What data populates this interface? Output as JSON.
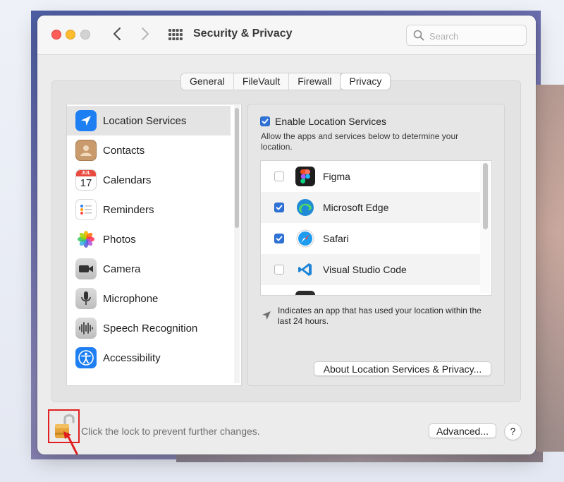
{
  "window": {
    "title": "Security & Privacy",
    "search_placeholder": "Search"
  },
  "tabs": [
    {
      "label": "General"
    },
    {
      "label": "FileVault"
    },
    {
      "label": "Firewall"
    },
    {
      "label": "Privacy",
      "active": true
    }
  ],
  "sidebar": {
    "items": [
      {
        "label": "Location Services",
        "icon": "location-arrow-icon",
        "selected": true
      },
      {
        "label": "Contacts",
        "icon": "contacts-icon"
      },
      {
        "label": "Calendars",
        "icon": "calendar-icon",
        "month": "JUL",
        "day": "17"
      },
      {
        "label": "Reminders",
        "icon": "reminders-icon"
      },
      {
        "label": "Photos",
        "icon": "photos-icon"
      },
      {
        "label": "Camera",
        "icon": "camera-icon"
      },
      {
        "label": "Microphone",
        "icon": "microphone-icon"
      },
      {
        "label": "Speech Recognition",
        "icon": "waveform-icon"
      },
      {
        "label": "Accessibility",
        "icon": "accessibility-icon"
      }
    ]
  },
  "location": {
    "enable_label": "Enable Location Services",
    "enabled": true,
    "description": "Allow the apps and services below to determine your location.",
    "apps": [
      {
        "name": "Figma",
        "checked": false,
        "icon": "figma-icon"
      },
      {
        "name": "Microsoft Edge",
        "checked": true,
        "icon": "edge-icon"
      },
      {
        "name": "Safari",
        "checked": true,
        "icon": "safari-icon"
      },
      {
        "name": "Visual Studio Code",
        "checked": false,
        "icon": "vscode-icon"
      }
    ],
    "hint": "Indicates an app that has used your location within the last 24 hours.",
    "about_button": "About Location Services & Privacy..."
  },
  "footer": {
    "lock_text": "Click the lock to prevent further changes.",
    "advanced_button": "Advanced...",
    "help_button": "?"
  },
  "colors": {
    "accent": "#2f73d9",
    "highlight_border": "#e02020"
  }
}
